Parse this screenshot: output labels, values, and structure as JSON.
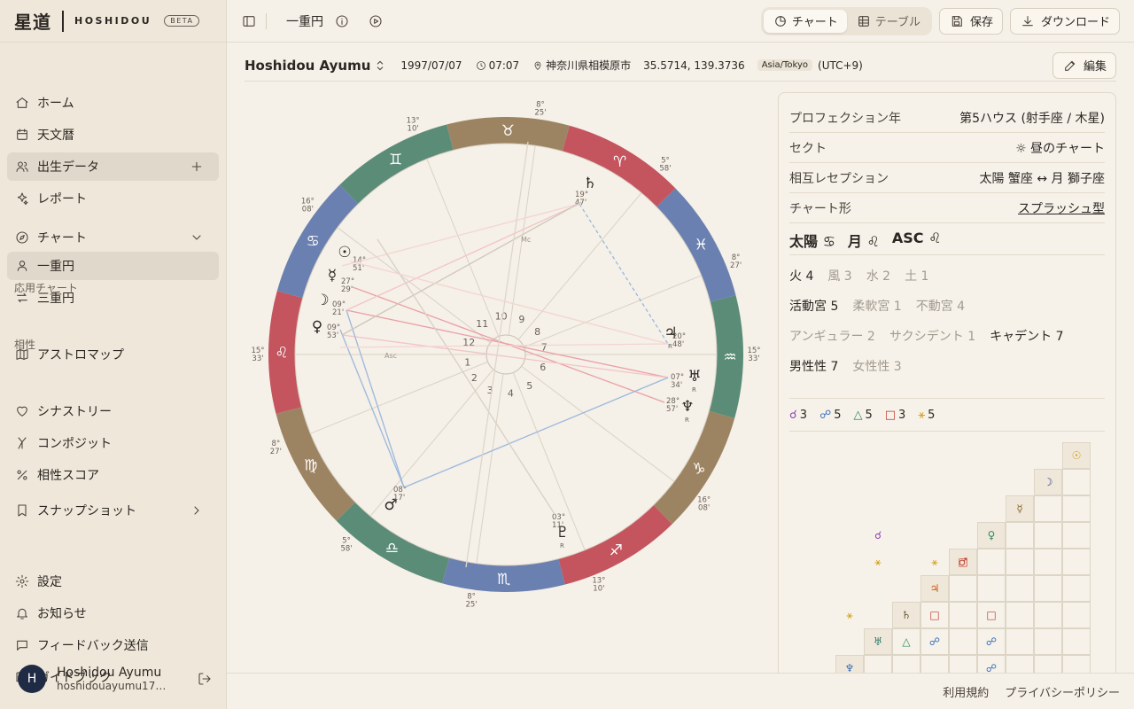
{
  "brand": {
    "kanji": "星道",
    "name": "HOSHIDOU",
    "badge": "BETA"
  },
  "sidebar": {
    "items": [
      {
        "label": "ホーム",
        "icon": "home-icon"
      },
      {
        "label": "天文暦",
        "icon": "calendar-icon"
      },
      {
        "label": "出生データ",
        "icon": "users-icon"
      },
      {
        "label": "レポート",
        "icon": "sparkle-icon"
      },
      {
        "label": "チャート",
        "icon": "compass-icon"
      },
      {
        "label": "一重円",
        "icon": "user-icon"
      },
      {
        "label": "三重円",
        "icon": "arrows-icon"
      },
      {
        "label": "アストロマップ",
        "icon": "map-icon"
      },
      {
        "label": "シナストリー",
        "icon": "heart-icon"
      },
      {
        "label": "コンポジット",
        "icon": "merge-icon"
      },
      {
        "label": "相性スコア",
        "icon": "percent-icon"
      },
      {
        "label": "スナップショット",
        "icon": "bookmark-icon"
      },
      {
        "label": "設定",
        "icon": "gear-icon"
      },
      {
        "label": "お知らせ",
        "icon": "bell-icon"
      },
      {
        "label": "フィードバック送信",
        "icon": "message-icon"
      },
      {
        "label": "ガイドブック",
        "icon": "book-icon"
      }
    ],
    "section_applied": "応用チャート",
    "section_compat": "相性"
  },
  "user": {
    "initial": "H",
    "name": "Hoshidou Ayumu",
    "email": "hoshidouayumu1781..."
  },
  "header": {
    "crumb": "一重円",
    "tab_chart": "チャート",
    "tab_table": "テーブル",
    "save": "保存",
    "download": "ダウンロード"
  },
  "profile": {
    "name": "Hoshidou Ayumu",
    "date": "1997/07/07",
    "time": "07:07",
    "place": "神奈川県相模原市",
    "coords": "35.5714, 139.3736",
    "timezone": "Asia/Tokyo",
    "offset": "(UTC+9)",
    "edit": "編集"
  },
  "panel": {
    "rows": [
      {
        "label": "プロフェクション年",
        "value": "第5ハウス (射手座 / 木星)"
      },
      {
        "label": "セクト",
        "value": "☼ 昼のチャート"
      },
      {
        "label": "相互レセプション",
        "value": "太陽 蟹座 ↔ 月 獅子座"
      },
      {
        "label": "チャート形",
        "value": "スプラッシュ型"
      }
    ],
    "trio": [
      "太陽 ♋",
      "月 ♌",
      "ASC ♌"
    ],
    "elements": [
      {
        "label": "火 4",
        "dim": false
      },
      {
        "label": "風 3",
        "dim": true
      },
      {
        "label": "水 2",
        "dim": true
      },
      {
        "label": "土 1",
        "dim": true
      }
    ],
    "modes": [
      {
        "label": "活動宮 5",
        "dim": false
      },
      {
        "label": "柔軟宮 1",
        "dim": true
      },
      {
        "label": "不動宮 4",
        "dim": true
      }
    ],
    "houses": [
      {
        "label": "アンギュラー 2",
        "dim": true
      },
      {
        "label": "サクシデント 1",
        "dim": true
      },
      {
        "label": "キャデント 7",
        "dim": false
      }
    ],
    "polarity": [
      {
        "label": "男性性 7",
        "dim": false
      },
      {
        "label": "女性性 3",
        "dim": true
      }
    ],
    "aspects": [
      {
        "glyph": "☌",
        "count": "3",
        "color": "#8e44ad"
      },
      {
        "glyph": "☍",
        "count": "5",
        "color": "#3b6fb6"
      },
      {
        "glyph": "△",
        "count": "5",
        "color": "#2e8b57"
      },
      {
        "glyph": "□",
        "count": "3",
        "color": "#c0392b"
      },
      {
        "glyph": "⚹",
        "count": "5",
        "color": "#d4a017"
      }
    ]
  },
  "grid": {
    "planets": [
      "☉",
      "☽",
      "☿",
      "♀",
      "♂",
      "♃",
      "♄",
      "♅",
      "♆"
    ],
    "planet_colors": [
      "#d4a017",
      "#3b4a8a",
      "#8a6a2a",
      "#2e8b57",
      "#c0392b",
      "#d35400",
      "#6b5a3a",
      "#2e7d6a",
      "#3b6fb6"
    ],
    "cells": [
      {
        "row": 3,
        "col": 1,
        "glyph": "☌",
        "color": "#8e44ad"
      },
      {
        "row": 4,
        "col": 1,
        "glyph": "⚹",
        "color": "#d4a017"
      },
      {
        "row": 4,
        "col": 3,
        "glyph": "⚹",
        "color": "#d4a017"
      },
      {
        "row": 4,
        "col": 4,
        "glyph": "□",
        "color": "#c0392b"
      },
      {
        "row": 6,
        "col": 0,
        "glyph": "⚹",
        "color": "#d4a017"
      },
      {
        "row": 6,
        "col": 3,
        "glyph": "□",
        "color": "#c0392b"
      },
      {
        "row": 6,
        "col": 5,
        "glyph": "□",
        "color": "#c0392b"
      },
      {
        "row": 7,
        "col": 2,
        "glyph": "△",
        "color": "#2e8b57"
      },
      {
        "row": 7,
        "col": 3,
        "glyph": "☍",
        "color": "#3b6fb6"
      },
      {
        "row": 7,
        "col": 5,
        "glyph": "☍",
        "color": "#3b6fb6"
      },
      {
        "row": 8,
        "col": 5,
        "glyph": "☍",
        "color": "#3b6fb6"
      }
    ]
  },
  "wheel": {
    "signs": [
      "♈",
      "♉",
      "♊",
      "♋",
      "♌",
      "♍",
      "♎",
      "♏",
      "♐",
      "♑",
      "♒",
      "♓"
    ],
    "sign_colors": [
      "#c4545e",
      "#9c8463",
      "#5a8c78",
      "#6a80b0"
    ],
    "houses": [
      "1",
      "2",
      "3",
      "4",
      "5",
      "6",
      "7",
      "8",
      "9",
      "10",
      "11",
      "12"
    ],
    "cusp_labels": [
      "15°\n33'",
      "8°\n27'",
      "5°\n58'",
      "8°\n25'",
      "13°\n10'",
      "16°\n08'",
      "15°\n33'",
      "8°\n27'",
      "5°\n58'",
      "8°\n25'",
      "13°\n10'",
      "16°\n08'"
    ],
    "planets": [
      {
        "glyph": "☉",
        "deg": "14°",
        "min": "51'",
        "r": ""
      },
      {
        "glyph": "☿",
        "deg": "27°",
        "min": "29'",
        "r": ""
      },
      {
        "glyph": "☽",
        "deg": "09°",
        "min": "21'",
        "r": ""
      },
      {
        "glyph": "♀",
        "deg": "09°",
        "min": "53'",
        "r": ""
      },
      {
        "glyph": "♂",
        "deg": "08°",
        "min": "17'",
        "r": ""
      },
      {
        "glyph": "♇",
        "deg": "03°",
        "min": "11'",
        "r": "R"
      },
      {
        "glyph": "♆",
        "deg": "28°",
        "min": "57'",
        "r": "R"
      },
      {
        "glyph": "♅",
        "deg": "07°",
        "min": "34'",
        "r": "R"
      },
      {
        "glyph": "♃",
        "deg": "20°",
        "min": "48'",
        "r": "R"
      },
      {
        "glyph": "♄",
        "deg": "19°",
        "min": "47'",
        "r": ""
      }
    ],
    "mc_label": "Mc",
    "asc_label": "Asc"
  },
  "footer": {
    "terms": "利用規約",
    "privacy": "プライバシーポリシー"
  }
}
